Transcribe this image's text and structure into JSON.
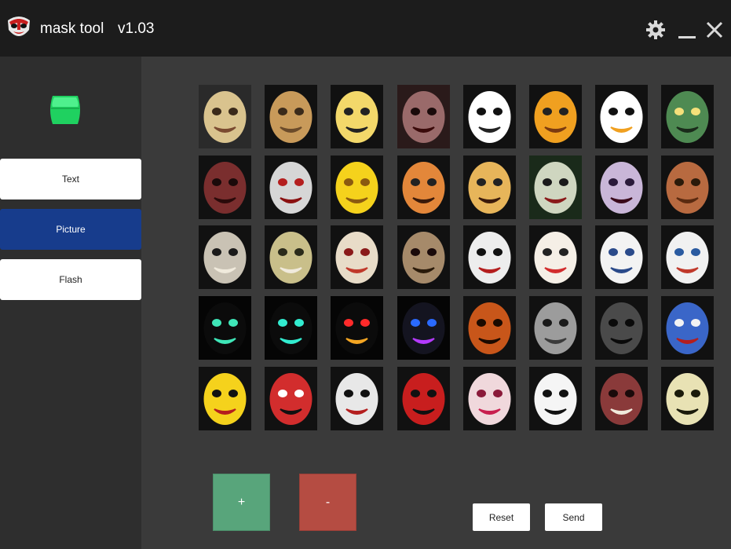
{
  "header": {
    "title": "mask tool",
    "version": "v1.03",
    "settings_icon": "gear-icon",
    "minimize_icon": "minimize-icon",
    "close_icon": "close-icon"
  },
  "sidebar": {
    "status_indicator_color": "#23e36b",
    "items": [
      {
        "label": "Text",
        "active": false
      },
      {
        "label": "Picture",
        "active": true
      },
      {
        "label": "Flash",
        "active": false
      }
    ],
    "active_color": "#173c8c"
  },
  "masks": [
    {
      "name": "monkey-king",
      "bg": "#2a2a2a",
      "face": "#d9c38e",
      "eye": "#3a2a1a",
      "mouth": "#7a4a30"
    },
    {
      "name": "ox",
      "bg": "#111111",
      "face": "#c89a5a",
      "eye": "#3a2a1a",
      "mouth": "#6b4b2a"
    },
    {
      "name": "tiger-cub",
      "bg": "#111111",
      "face": "#f3d86a",
      "eye": "#222222",
      "mouth": "#222222"
    },
    {
      "name": "zombie",
      "bg": "#2a1a1a",
      "face": "#9a6a6a",
      "eye": "#1a0a0a",
      "mouth": "#3a0a0a"
    },
    {
      "name": "panda",
      "bg": "#111111",
      "face": "#ffffff",
      "eye": "#111111",
      "mouth": "#222222"
    },
    {
      "name": "cartoon-tiger",
      "bg": "#111111",
      "face": "#f0a020",
      "eye": "#222222",
      "mouth": "#7a3a10"
    },
    {
      "name": "chicken",
      "bg": "#111111",
      "face": "#ffffff",
      "eye": "#111111",
      "mouth": "#f0a020"
    },
    {
      "name": "green-demon",
      "bg": "#111111",
      "face": "#4e8a52",
      "eye": "#f5e07a",
      "mouth": "#1a2a1a"
    },
    {
      "name": "burnt-face",
      "bg": "#111111",
      "face": "#7a2e2e",
      "eye": "#1a0a0a",
      "mouth": "#2a0a0a"
    },
    {
      "name": "evil-clown",
      "bg": "#111111",
      "face": "#d6d6d6",
      "eye": "#b41e1e",
      "mouth": "#8a1010"
    },
    {
      "name": "sun",
      "bg": "#111111",
      "face": "#f5d21c",
      "eye": "#8a5a10",
      "mouth": "#8a5a10"
    },
    {
      "name": "tiger-face",
      "bg": "#111111",
      "face": "#e3873a",
      "eye": "#222222",
      "mouth": "#3a1a0a"
    },
    {
      "name": "leopard",
      "bg": "#111111",
      "face": "#e7b55a",
      "eye": "#222222",
      "mouth": "#3a1a0a"
    },
    {
      "name": "joker",
      "bg": "#1a2a1a",
      "face": "#cfd6c0",
      "eye": "#1a1a1a",
      "mouth": "#8a1a1a"
    },
    {
      "name": "ghost-woman",
      "bg": "#111111",
      "face": "#c9b6d8",
      "eye": "#2a1a3a",
      "mouth": "#3a0a1a"
    },
    {
      "name": "skinless",
      "bg": "#111111",
      "face": "#b86a40",
      "eye": "#2a1a0a",
      "mouth": "#5a2a10"
    },
    {
      "name": "bear-teeth",
      "bg": "#111111",
      "face": "#c9c2b4",
      "eye": "#1a1a1a",
      "mouth": "#f0eadc"
    },
    {
      "name": "hannya",
      "bg": "#111111",
      "face": "#c9bf8a",
      "eye": "#2a2a1a",
      "mouth": "#f0eadc"
    },
    {
      "name": "angry-clown",
      "bg": "#111111",
      "face": "#e8dcc8",
      "eye": "#8a1a1a",
      "mouth": "#c0392b"
    },
    {
      "name": "skull",
      "bg": "#111111",
      "face": "#a68a6a",
      "eye": "#1a0a0a",
      "mouth": "#2a1a0a"
    },
    {
      "name": "saw-puppet",
      "bg": "#111111",
      "face": "#ededed",
      "eye": "#111111",
      "mouth": "#b41e1e"
    },
    {
      "name": "santa",
      "bg": "#111111",
      "face": "#f5efe6",
      "eye": "#222222",
      "mouth": "#d22d2d"
    },
    {
      "name": "heist-clown",
      "bg": "#111111",
      "face": "#f3f3f3",
      "eye": "#2a4a8a",
      "mouth": "#2a4a8a"
    },
    {
      "name": "blue-clown",
      "bg": "#111111",
      "face": "#f1f1f1",
      "eye": "#2a5aa0",
      "mouth": "#c0392b"
    },
    {
      "name": "neon-grin",
      "bg": "#050505",
      "face": "#0b0b0b",
      "eye": "#3fe6b8",
      "mouth": "#3fe6b8"
    },
    {
      "name": "neon-venom",
      "bg": "#050505",
      "face": "#0b0b0b",
      "eye": "#32ecd0",
      "mouth": "#32ecd0"
    },
    {
      "name": "red-eyes",
      "bg": "#050505",
      "face": "#0b0b0b",
      "eye": "#ff2a2a",
      "mouth": "#f5a623"
    },
    {
      "name": "purge-mask",
      "bg": "#050505",
      "face": "#141420",
      "eye": "#2a6aff",
      "mouth": "#b43aff"
    },
    {
      "name": "pumpkin",
      "bg": "#111111",
      "face": "#c8561a",
      "eye": "#1a0a00",
      "mouth": "#1a0a00"
    },
    {
      "name": "grey-woman",
      "bg": "#111111",
      "face": "#9c9c9c",
      "eye": "#1a1a1a",
      "mouth": "#3a3a3a"
    },
    {
      "name": "dark-skull",
      "bg": "#111111",
      "face": "#4a4a4a",
      "eye": "#0a0a0a",
      "mouth": "#0a0a0a"
    },
    {
      "name": "opera-blue",
      "bg": "#111111",
      "face": "#3a66c8",
      "eye": "#f3f3f3",
      "mouth": "#b41e1e"
    },
    {
      "name": "opera-yellow",
      "bg": "#111111",
      "face": "#f5d21c",
      "eye": "#111111",
      "mouth": "#b41e1e"
    },
    {
      "name": "opera-red",
      "bg": "#111111",
      "face": "#d22d2d",
      "eye": "#ffffff",
      "mouth": "#111111"
    },
    {
      "name": "opera-white",
      "bg": "#111111",
      "face": "#e8e8e8",
      "eye": "#111111",
      "mouth": "#b41e1e"
    },
    {
      "name": "opera-crimson",
      "bg": "#111111",
      "face": "#c81e1e",
      "eye": "#111111",
      "mouth": "#111111"
    },
    {
      "name": "opera-pink",
      "bg": "#111111",
      "face": "#f0d8dc",
      "eye": "#8a1a3a",
      "mouth": "#c81e4e"
    },
    {
      "name": "scream",
      "bg": "#111111",
      "face": "#f5f5f5",
      "eye": "#111111",
      "mouth": "#111111"
    },
    {
      "name": "red-fangs",
      "bg": "#111111",
      "face": "#8a3a3a",
      "eye": "#1a0a0a",
      "mouth": "#f0eadc"
    },
    {
      "name": "cream-skull",
      "bg": "#111111",
      "face": "#e8e2b4",
      "eye": "#1a1a0a",
      "mouth": "#1a1a0a"
    }
  ],
  "actions": {
    "add_label": "+",
    "remove_label": "-",
    "reset_label": "Reset",
    "send_label": "Send",
    "add_color": "#58a57b",
    "remove_color": "#b54c42"
  }
}
